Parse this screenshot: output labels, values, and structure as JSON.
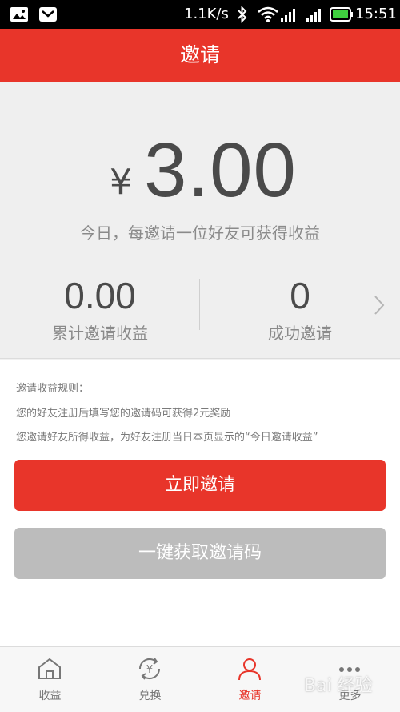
{
  "status_bar": {
    "speed": "1.1K/s",
    "time": "15:51"
  },
  "title": "邀请",
  "hero": {
    "currency_symbol": "¥",
    "amount": "3.00",
    "subtitle": "今日，每邀请一位好友可获得收益"
  },
  "stats": [
    {
      "value": "0.00",
      "label": "累计邀请收益"
    },
    {
      "value": "0",
      "label": "成功邀请"
    }
  ],
  "rules": {
    "heading": "邀请收益规则：",
    "lines": [
      "您的好友注册后填写您的邀请码可获得2元奖励",
      "您邀请好友所得收益，为好友注册当日本页显示的“今日邀请收益”"
    ]
  },
  "buttons": {
    "invite_now": "立即邀请",
    "get_code": "一键获取邀请码"
  },
  "tabs": [
    {
      "label": "收益",
      "icon": "home-icon"
    },
    {
      "label": "兑换",
      "icon": "exchange-yuan-icon"
    },
    {
      "label": "邀请",
      "icon": "person-icon",
      "active": true
    },
    {
      "label": "更多",
      "icon": "more-dots-icon"
    }
  ],
  "colors": {
    "accent": "#e8352a",
    "disabled_button": "#bcbcbc"
  },
  "watermark": "Bai 经验"
}
